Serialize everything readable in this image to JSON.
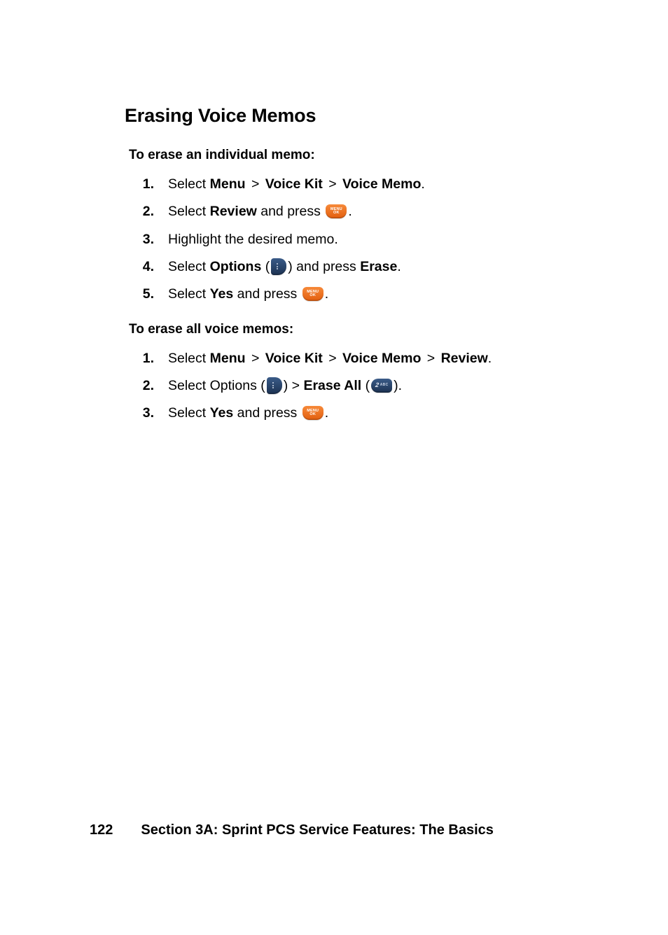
{
  "heading": "Erasing Voice Memos",
  "footer": {
    "page": "122",
    "label": "Section 3A: Sprint PCS Service Features: The Basics"
  },
  "sec1": {
    "intro": "To erase an individual memo:",
    "s1": {
      "pre": "Select ",
      "menu": "Menu",
      "vk": "Voice Kit",
      "vm": "Voice Memo",
      "post": "."
    },
    "s2": {
      "pre": "Select ",
      "review": "Review",
      "mid": " and press ",
      "post": "."
    },
    "s3": {
      "text": "Highlight the desired memo."
    },
    "s4": {
      "pre": "Select ",
      "options": "Options",
      "lp": " (",
      "rp": ") ",
      "mid": "and press ",
      "erase": "Erase",
      "post": "."
    },
    "s5": {
      "pre": "Select ",
      "yes": "Yes",
      "mid": " and press ",
      "post": "."
    }
  },
  "sec2": {
    "intro": "To erase all voice memos:",
    "s1": {
      "pre": "Select ",
      "menu": "Menu",
      "vk": "Voice Kit",
      "vm": "Voice Memo",
      "rv": "Review",
      "post": "."
    },
    "s2": {
      "pre": "Select Options (",
      "mid1": ") > ",
      "ea": "Erase All",
      "lp": " (",
      "rp": ").",
      "post": ""
    },
    "s3": {
      "pre": "Select ",
      "yes": "Yes",
      "mid": " and press ",
      "post": "."
    }
  },
  "sep": " > ",
  "keys": {
    "menu_l1": "MENU",
    "menu_l2": "OK",
    "num2_n": "2",
    "num2_abc": "ABC"
  }
}
